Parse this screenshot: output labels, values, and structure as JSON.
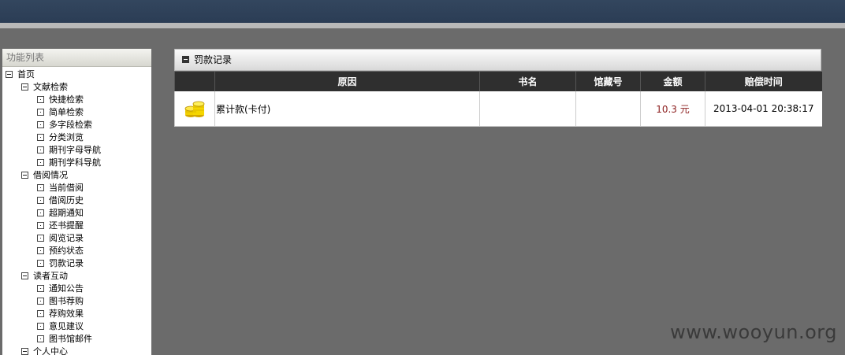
{
  "sidebar": {
    "title": "功能列表",
    "tree": [
      {
        "label": "首页",
        "level": 0,
        "expanded": true
      },
      {
        "label": "文献检索",
        "level": 1,
        "expanded": true
      },
      {
        "label": "快捷检索",
        "level": 2
      },
      {
        "label": "简单检索",
        "level": 2
      },
      {
        "label": "多字段检索",
        "level": 2
      },
      {
        "label": "分类浏览",
        "level": 2
      },
      {
        "label": "期刊字母导航",
        "level": 2
      },
      {
        "label": "期刊学科导航",
        "level": 2
      },
      {
        "label": "借阅情况",
        "level": 1,
        "expanded": true
      },
      {
        "label": "当前借阅",
        "level": 2
      },
      {
        "label": "借阅历史",
        "level": 2
      },
      {
        "label": "超期通知",
        "level": 2
      },
      {
        "label": "还书提醒",
        "level": 2
      },
      {
        "label": "阅览记录",
        "level": 2
      },
      {
        "label": "预约状态",
        "level": 2
      },
      {
        "label": "罚款记录",
        "level": 2
      },
      {
        "label": "读者互动",
        "level": 1,
        "expanded": true
      },
      {
        "label": "通知公告",
        "level": 2
      },
      {
        "label": "图书荐购",
        "level": 2
      },
      {
        "label": "荐购效果",
        "level": 2
      },
      {
        "label": "意见建议",
        "level": 2
      },
      {
        "label": "图书馆邮件",
        "level": 2
      },
      {
        "label": "个人中心",
        "level": 1,
        "expanded": true
      }
    ]
  },
  "panel": {
    "title": "罚款记录",
    "columns": [
      "",
      "原因",
      "书名",
      "馆藏号",
      "金额",
      "赔偿时间"
    ],
    "rows": [
      {
        "icon": "coins-icon",
        "reason": "累计款(卡付)",
        "book": "",
        "call_no": "",
        "amount": "10.3 元",
        "time": "2013-04-01 20:38:17"
      }
    ]
  },
  "watermark": "www.wooyun.org",
  "colors": {
    "topbar": "#2e415a",
    "table_header": "#2f2f2f",
    "amount": "#8b1c1c",
    "background": "#6b6b6b"
  }
}
